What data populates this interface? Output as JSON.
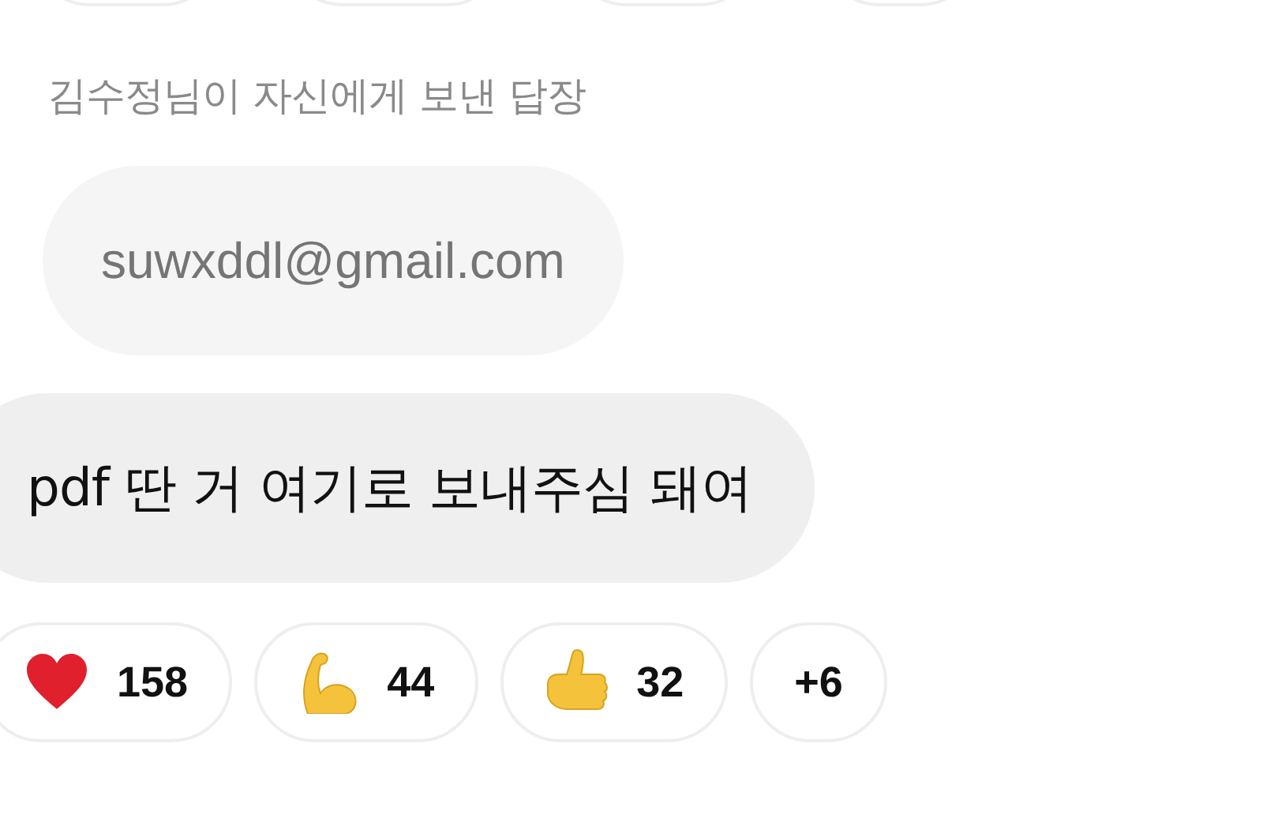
{
  "previous_reactions": [
    {
      "kind": "pill"
    },
    {
      "kind": "pill"
    },
    {
      "kind": "pill"
    },
    {
      "kind": "pill"
    }
  ],
  "reply_label": "김수정님이 자신에게 보낸 답장",
  "quoted_message": "suwxddl@gmail.com",
  "message": "pdf 딴 거 여기로 보내주심 돼여",
  "reactions": [
    {
      "kind": "heart",
      "count": "158"
    },
    {
      "kind": "muscle",
      "count": "44"
    },
    {
      "kind": "thumbs",
      "count": "32"
    },
    {
      "kind": "more",
      "count": "+6"
    }
  ]
}
